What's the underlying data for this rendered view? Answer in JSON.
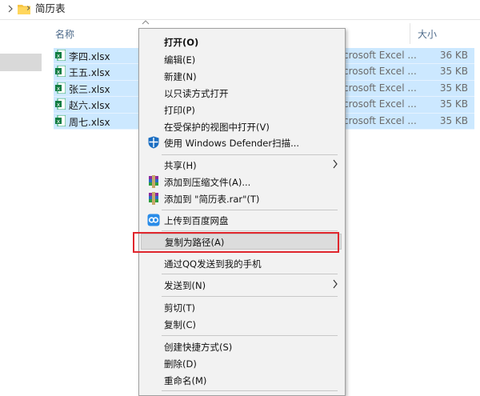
{
  "window": {
    "title": "简历表",
    "icons": [
      "chevron-right-icon",
      "folder-icon"
    ]
  },
  "columns": {
    "name": "名称",
    "size": "大小"
  },
  "files": [
    {
      "name": "李四.xlsx",
      "type": "crosoft Excel ...",
      "size": "36 KB"
    },
    {
      "name": "王五.xlsx",
      "type": "crosoft Excel ...",
      "size": "35 KB"
    },
    {
      "name": "张三.xlsx",
      "type": "crosoft Excel ...",
      "size": "35 KB"
    },
    {
      "name": "赵六.xlsx",
      "type": "crosoft Excel ...",
      "size": "35 KB"
    },
    {
      "name": "周七.xlsx",
      "type": "crosoft Excel ...",
      "size": "35 KB"
    }
  ],
  "context_menu": {
    "open": "打开(O)",
    "edit": "编辑(E)",
    "new": "新建(N)",
    "open_readonly": "以只读方式打开",
    "print": "打印(P)",
    "open_protected": "在受保护的视图中打开(V)",
    "defender": "使用 Windows Defender扫描...",
    "share": "共享(H)",
    "add_archive": "添加到压缩文件(A)...",
    "add_rar": "添加到 \"简历表.rar\"(T)",
    "upload_baidu": "上传到百度网盘",
    "copy_path": "复制为路径(A)",
    "send_qq": "通过QQ发送到我的手机",
    "send_to": "发送到(N)",
    "cut": "剪切(T)",
    "copy": "复制(C)",
    "create_shortcut": "创建快捷方式(S)",
    "delete": "删除(D)",
    "rename": "重命名(M)"
  },
  "colors": {
    "selection": "#cce8ff",
    "highlight_box": "#e0262d",
    "menu_bg": "#f2f2f2"
  }
}
